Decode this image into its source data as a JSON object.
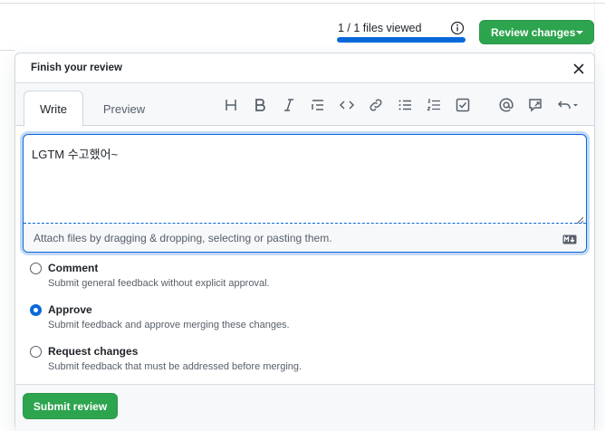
{
  "header": {
    "files_viewed": "1 / 1 files viewed",
    "files_viewed_progress": 1.0,
    "review_button_label": "Review changes"
  },
  "popover": {
    "title": "Finish your review",
    "tabs": [
      {
        "label": "Write",
        "selected": true
      },
      {
        "label": "Preview",
        "selected": false
      }
    ],
    "toolbar_icons": [
      "heading-icon",
      "bold-icon",
      "italic-icon",
      "quote-icon",
      "code-icon",
      "link-icon",
      "unordered-list-icon",
      "ordered-list-icon",
      "task-list-icon",
      "mention-icon",
      "reference-icon",
      "undo-icon"
    ],
    "editor": {
      "value": "LGTM 수고했어~",
      "attach_hint": "Attach files by dragging & dropping, selecting or pasting them."
    },
    "options": [
      {
        "label": "Comment",
        "description": "Submit general feedback without explicit approval.",
        "checked": false
      },
      {
        "label": "Approve",
        "description": "Submit feedback and approve merging these changes.",
        "checked": true
      },
      {
        "label": "Request changes",
        "description": "Submit feedback that must be addressed before merging.",
        "checked": false
      }
    ],
    "submit_label": "Submit review"
  },
  "colors": {
    "accent": "#0969da",
    "primary_button": "#2da44e",
    "border": "#d0d7de",
    "muted_text": "#57606a"
  }
}
